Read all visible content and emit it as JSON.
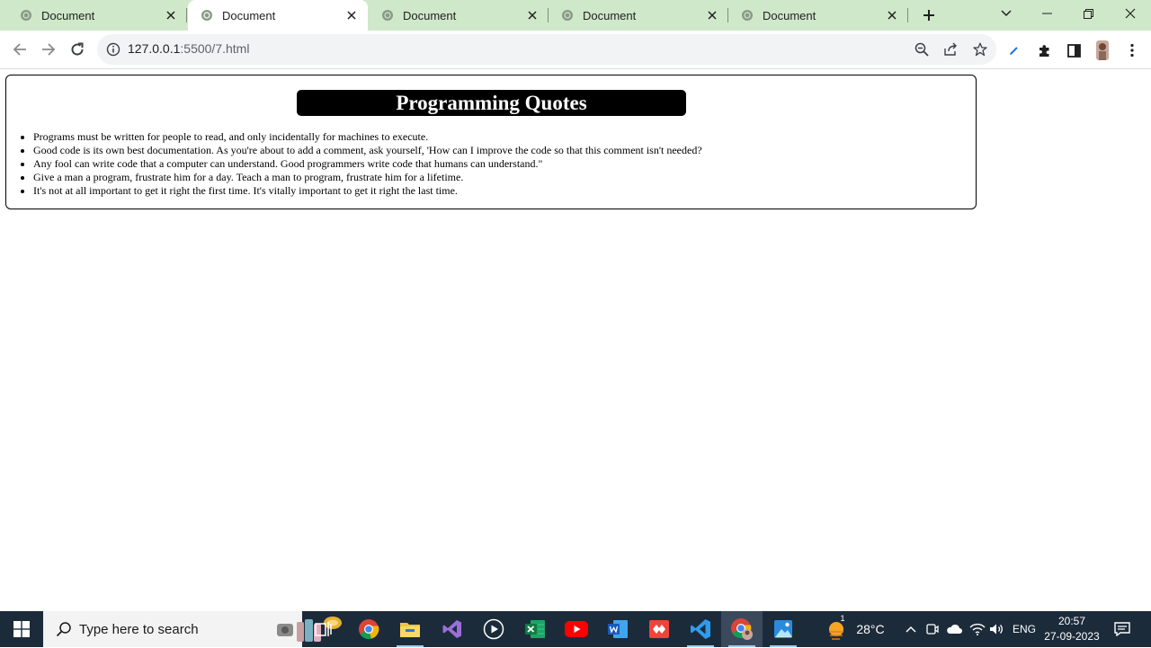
{
  "browser": {
    "tabs": [
      {
        "title": "Document",
        "active": false
      },
      {
        "title": "Document",
        "active": true
      },
      {
        "title": "Document",
        "active": false
      },
      {
        "title": "Document",
        "active": false
      },
      {
        "title": "Document",
        "active": false
      }
    ],
    "url_host": "127.0.0.1",
    "url_rest": ":5500/7.html"
  },
  "page": {
    "heading": "Programming Quotes",
    "quotes": [
      "Programs must be written for people to read, and only incidentally for machines to execute.",
      "Good code is its own best documentation. As you're about to add a comment, ask yourself, 'How can I improve the code so that this comment isn't needed?",
      "Any fool can write code that a computer can understand. Good programmers write code that humans can understand.\"",
      "Give a man a program, frustrate him for a day. Teach a man to program, frustrate him for a lifetime.",
      "It's not at all important to get it right the first time. It's vitally important to get it right the last time."
    ]
  },
  "taskbar": {
    "search_placeholder": "Type here to search",
    "weather": "28°C",
    "weather_badge": "1",
    "language": "ENG",
    "time": "20:57",
    "date": "27-09-2023"
  }
}
